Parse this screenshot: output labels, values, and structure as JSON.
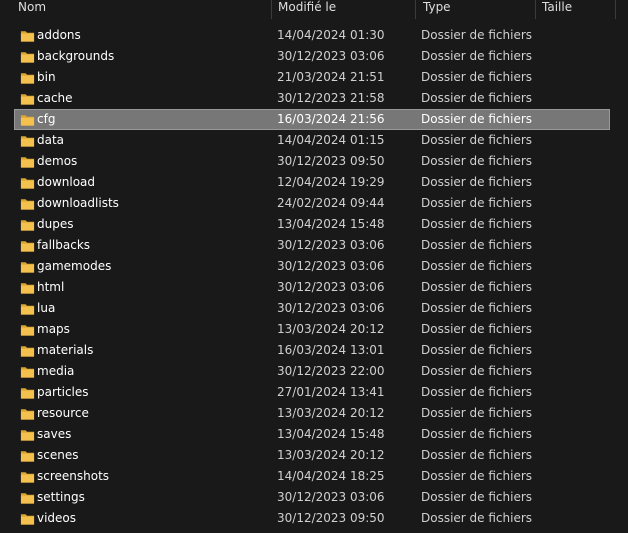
{
  "colors": {
    "background": "#191919",
    "selection": "#777777",
    "folder": "#f4c04e"
  },
  "columns": {
    "name": "Nom",
    "date": "Modifié le",
    "type": "Type",
    "size": "Taille"
  },
  "selected_index": 4,
  "rows": [
    {
      "name": "addons",
      "date": "14/04/2024 01:30",
      "type": "Dossier de fichiers",
      "icon": "folder-icon"
    },
    {
      "name": "backgrounds",
      "date": "30/12/2023 03:06",
      "type": "Dossier de fichiers",
      "icon": "folder-icon"
    },
    {
      "name": "bin",
      "date": "21/03/2024 21:51",
      "type": "Dossier de fichiers",
      "icon": "folder-icon"
    },
    {
      "name": "cache",
      "date": "30/12/2023 21:58",
      "type": "Dossier de fichiers",
      "icon": "folder-icon"
    },
    {
      "name": "cfg",
      "date": "16/03/2024 21:56",
      "type": "Dossier de fichiers",
      "icon": "folder-icon"
    },
    {
      "name": "data",
      "date": "14/04/2024 01:15",
      "type": "Dossier de fichiers",
      "icon": "folder-icon"
    },
    {
      "name": "demos",
      "date": "30/12/2023 09:50",
      "type": "Dossier de fichiers",
      "icon": "folder-icon"
    },
    {
      "name": "download",
      "date": "12/04/2024 19:29",
      "type": "Dossier de fichiers",
      "icon": "folder-icon"
    },
    {
      "name": "downloadlists",
      "date": "24/02/2024 09:44",
      "type": "Dossier de fichiers",
      "icon": "folder-icon"
    },
    {
      "name": "dupes",
      "date": "13/04/2024 15:48",
      "type": "Dossier de fichiers",
      "icon": "folder-icon"
    },
    {
      "name": "fallbacks",
      "date": "30/12/2023 03:06",
      "type": "Dossier de fichiers",
      "icon": "folder-icon"
    },
    {
      "name": "gamemodes",
      "date": "30/12/2023 03:06",
      "type": "Dossier de fichiers",
      "icon": "folder-icon"
    },
    {
      "name": "html",
      "date": "30/12/2023 03:06",
      "type": "Dossier de fichiers",
      "icon": "folder-icon"
    },
    {
      "name": "lua",
      "date": "30/12/2023 03:06",
      "type": "Dossier de fichiers",
      "icon": "folder-icon"
    },
    {
      "name": "maps",
      "date": "13/03/2024 20:12",
      "type": "Dossier de fichiers",
      "icon": "folder-icon"
    },
    {
      "name": "materials",
      "date": "16/03/2024 13:01",
      "type": "Dossier de fichiers",
      "icon": "folder-icon"
    },
    {
      "name": "media",
      "date": "30/12/2023 22:00",
      "type": "Dossier de fichiers",
      "icon": "folder-icon"
    },
    {
      "name": "particles",
      "date": "27/01/2024 13:41",
      "type": "Dossier de fichiers",
      "icon": "folder-icon"
    },
    {
      "name": "resource",
      "date": "13/03/2024 20:12",
      "type": "Dossier de fichiers",
      "icon": "folder-icon"
    },
    {
      "name": "saves",
      "date": "13/04/2024 15:48",
      "type": "Dossier de fichiers",
      "icon": "folder-icon"
    },
    {
      "name": "scenes",
      "date": "13/03/2024 20:12",
      "type": "Dossier de fichiers",
      "icon": "folder-icon"
    },
    {
      "name": "screenshots",
      "date": "14/04/2024 18:25",
      "type": "Dossier de fichiers",
      "icon": "folder-icon"
    },
    {
      "name": "settings",
      "date": "30/12/2023 03:06",
      "type": "Dossier de fichiers",
      "icon": "folder-icon"
    },
    {
      "name": "videos",
      "date": "30/12/2023 09:50",
      "type": "Dossier de fichiers",
      "icon": "folder-icon"
    }
  ]
}
